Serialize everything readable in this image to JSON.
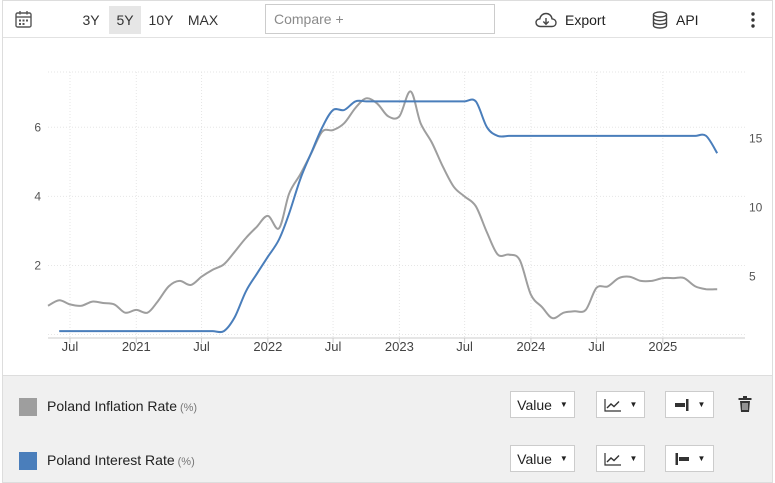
{
  "toolbar": {
    "ranges": [
      "3Y",
      "5Y",
      "10Y",
      "MAX"
    ],
    "active_range": "5Y",
    "compare_placeholder": "Compare +",
    "export_label": "Export",
    "api_label": "API",
    "icons": [
      "calendar-icon",
      "cloud-download-icon",
      "database-icon",
      "more-vertical-icon"
    ]
  },
  "chart_data": {
    "type": "line",
    "x_ticks": [
      "Jul",
      "2021",
      "Jul",
      "2022",
      "Jul",
      "2023",
      "Jul",
      "2024",
      "Jul",
      "2025"
    ],
    "left_axis": {
      "ticks": [
        2,
        4,
        6
      ],
      "range": [
        -0.1,
        7.6
      ]
    },
    "right_axis": {
      "ticks": [
        5,
        10,
        15
      ],
      "range": [
        0.57,
        19.8
      ]
    },
    "grid": true,
    "series": [
      {
        "name": "Poland Interest Rate",
        "unit": "%",
        "axis": "left",
        "color": "#4a7ebb",
        "x": [
          "2020-06",
          "2020-07",
          "2020-08",
          "2020-09",
          "2020-10",
          "2020-11",
          "2020-12",
          "2021-01",
          "2021-02",
          "2021-03",
          "2021-04",
          "2021-05",
          "2021-06",
          "2021-07",
          "2021-08",
          "2021-09",
          "2021-10",
          "2021-11",
          "2021-12",
          "2022-01",
          "2022-02",
          "2022-03",
          "2022-04",
          "2022-05",
          "2022-06",
          "2022-07",
          "2022-08",
          "2022-09",
          "2022-10",
          "2022-11",
          "2022-12",
          "2023-01",
          "2023-02",
          "2023-03",
          "2023-04",
          "2023-05",
          "2023-06",
          "2023-07",
          "2023-08",
          "2023-09",
          "2023-10",
          "2023-11",
          "2023-12",
          "2024-01",
          "2024-02",
          "2024-03",
          "2024-04",
          "2024-05",
          "2024-06",
          "2024-07",
          "2024-08",
          "2024-09",
          "2024-10",
          "2024-11",
          "2024-12",
          "2025-01",
          "2025-02",
          "2025-03",
          "2025-04",
          "2025-05",
          "2025-06"
        ],
        "values": [
          0.1,
          0.1,
          0.1,
          0.1,
          0.1,
          0.1,
          0.1,
          0.1,
          0.1,
          0.1,
          0.1,
          0.1,
          0.1,
          0.1,
          0.1,
          0.1,
          0.5,
          1.25,
          1.75,
          2.25,
          2.75,
          3.5,
          4.5,
          5.25,
          6.0,
          6.5,
          6.5,
          6.75,
          6.75,
          6.75,
          6.75,
          6.75,
          6.75,
          6.75,
          6.75,
          6.75,
          6.75,
          6.75,
          6.75,
          6.0,
          5.75,
          5.75,
          5.75,
          5.75,
          5.75,
          5.75,
          5.75,
          5.75,
          5.75,
          5.75,
          5.75,
          5.75,
          5.75,
          5.75,
          5.75,
          5.75,
          5.75,
          5.75,
          5.75,
          5.75,
          5.25
        ]
      },
      {
        "name": "Poland Inflation Rate",
        "unit": "%",
        "axis": "right",
        "color": "#9e9e9e",
        "x": [
          "2020-05",
          "2020-06",
          "2020-07",
          "2020-08",
          "2020-09",
          "2020-10",
          "2020-11",
          "2020-12",
          "2021-01",
          "2021-02",
          "2021-03",
          "2021-04",
          "2021-05",
          "2021-06",
          "2021-07",
          "2021-08",
          "2021-09",
          "2021-10",
          "2021-11",
          "2021-12",
          "2022-01",
          "2022-02",
          "2022-03",
          "2022-04",
          "2022-05",
          "2022-06",
          "2022-07",
          "2022-08",
          "2022-09",
          "2022-10",
          "2022-11",
          "2022-12",
          "2023-01",
          "2023-02",
          "2023-03",
          "2023-04",
          "2023-05",
          "2023-06",
          "2023-07",
          "2023-08",
          "2023-09",
          "2023-10",
          "2023-11",
          "2023-12",
          "2024-01",
          "2024-02",
          "2024-03",
          "2024-04",
          "2024-05",
          "2024-06",
          "2024-07",
          "2024-08",
          "2024-09",
          "2024-10",
          "2024-11",
          "2024-12",
          "2025-01",
          "2025-02",
          "2025-03",
          "2025-04",
          "2025-05",
          "2025-06"
        ],
        "values": [
          2.9,
          3.3,
          3.0,
          2.9,
          3.2,
          3.1,
          3.0,
          2.4,
          2.6,
          2.4,
          3.2,
          4.3,
          4.7,
          4.4,
          5.0,
          5.5,
          5.9,
          6.8,
          7.8,
          8.6,
          9.4,
          8.5,
          11.0,
          12.4,
          13.9,
          15.5,
          15.6,
          16.1,
          17.2,
          17.9,
          17.5,
          16.6,
          16.6,
          18.4,
          16.1,
          14.7,
          13.0,
          11.5,
          10.8,
          10.1,
          8.2,
          6.6,
          6.6,
          6.2,
          3.7,
          2.8,
          2.0,
          2.4,
          2.5,
          2.6,
          4.2,
          4.3,
          4.9,
          5.0,
          4.7,
          4.7,
          4.9,
          4.9,
          4.9,
          4.3,
          4.1,
          4.1
        ]
      }
    ]
  },
  "legend": {
    "rows": [
      {
        "name": "Poland Inflation Rate",
        "unit": "(%)",
        "color": "#9e9e9e",
        "value_label": "Value"
      },
      {
        "name": "Poland Interest Rate",
        "unit": "(%)",
        "color": "#4a7ebb",
        "value_label": "Value"
      }
    ]
  }
}
